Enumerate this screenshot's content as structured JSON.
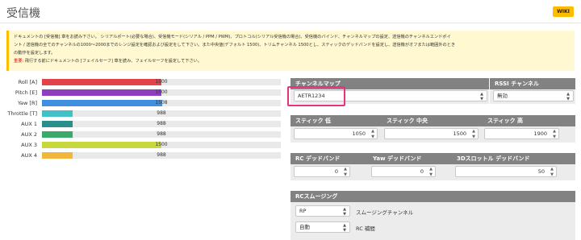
{
  "header": {
    "title": "受信機",
    "wiki_label": "WIKI"
  },
  "notice": {
    "line1": "ドキュメントの [受信機] 章をお読み下さい。 シリアルポート(必要な場合)、受信機モード(シリアル / PPM / PWM)、プロトコル(シリアル受信機の場合)、受信機のバインド、チャンネルマップの設定、送信機のチャンネルエンドポイ",
    "line2": "ント / 送信機の全てのチャンネルの1000〜2000までのレンジ設定を確認および設定をして下さい。また中央値(デフォルト 1500)、トリムチャンネル 1500とし、スティックのデッドバンドを設定し、送信機がオフまたは範囲外のとき",
    "line3": "の動作を設定します。",
    "warn_prefix": "重要:",
    "warn_text": " 飛行する前にドキュメントの [フェイルセーフ] 章を読み、フェイルセーフを設定して下さい。"
  },
  "channels": [
    {
      "label": "Roll [A]",
      "value": "1500",
      "level": 0.5,
      "color": "#e2424a"
    },
    {
      "label": "Pitch [E]",
      "value": "1500",
      "level": 0.5,
      "color": "#8d3fbf"
    },
    {
      "label": "Yaw [R]",
      "value": "1508",
      "level": 0.504,
      "color": "#3f8fe0"
    },
    {
      "label": "Throttle [T]",
      "value": "988",
      "level": 0.13,
      "color": "#42c0c8"
    },
    {
      "label": "AUX 1",
      "value": "988",
      "level": 0.13,
      "color": "#2a8f8a"
    },
    {
      "label": "AUX 2",
      "value": "988",
      "level": 0.13,
      "color": "#3ba86c"
    },
    {
      "label": "AUX 3",
      "value": "1500",
      "level": 0.5,
      "color": "#c6d83c"
    },
    {
      "label": "AUX 4",
      "value": "988",
      "level": 0.13,
      "color": "#f2b63c"
    }
  ],
  "channel_map": {
    "header": "チャンネルマップ",
    "value": "AETR1234"
  },
  "rssi": {
    "header": "RSSI チャンネル",
    "value": "無効"
  },
  "stick": {
    "low_header": "スティック 低",
    "low_value": "1050",
    "center_header": "スティック 中央",
    "center_value": "1500",
    "high_header": "スティック 高",
    "high_value": "1900"
  },
  "deadband": {
    "rc_header": "RC デッドバンド",
    "rc_value": "0",
    "yaw_header": "Yaw デッドバンド",
    "yaw_value": "0",
    "throttle3d_header": "3Dスロットル デッドバンド",
    "throttle3d_value": "50"
  },
  "smoothing": {
    "header": "RCスムージング",
    "channel_select": "RP",
    "channel_label": "スムージングチャンネル",
    "interp_select": "自動",
    "interp_label": "RC 補間"
  }
}
